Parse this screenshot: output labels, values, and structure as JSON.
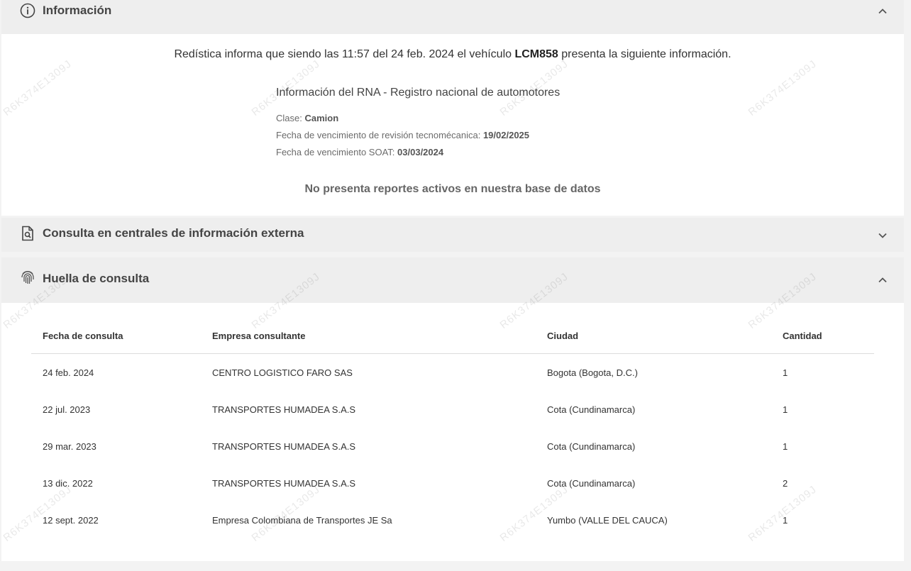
{
  "info_panel": {
    "title": "Información",
    "intro": {
      "prefix": "Redística informa que siendo las 11:57 del 24 feb. 2024 el vehículo ",
      "plate": "LCM858",
      "suffix": " presenta la siguiente información."
    },
    "rna": {
      "title": "Información del RNA - Registro nacional de automotores",
      "clase_label": "Clase:",
      "clase_value": "Camion",
      "tecno_label": "Fecha de vencimiento de revisión tecnomécanica:",
      "tecno_value": "19/02/2025",
      "soat_label": "Fecha de vencimiento SOAT:",
      "soat_value": "03/03/2024"
    },
    "no_reports": "No presenta reportes activos en nuestra base de datos"
  },
  "external_panel": {
    "title": "Consulta en centrales de información externa"
  },
  "huella_panel": {
    "title": "Huella de consulta",
    "columns": [
      "Fecha de consulta",
      "Empresa consultante",
      "Ciudad",
      "Cantidad"
    ],
    "rows": [
      [
        "24 feb. 2024",
        "CENTRO LOGISTICO FARO SAS",
        "Bogota (Bogota, D.C.)",
        "1"
      ],
      [
        "22 jul. 2023",
        "TRANSPORTES HUMADEA S.A.S",
        "Cota (Cundinamarca)",
        "1"
      ],
      [
        "29 mar. 2023",
        "TRANSPORTES HUMADEA S.A.S",
        "Cota (Cundinamarca)",
        "1"
      ],
      [
        "13 dic. 2022",
        "TRANSPORTES HUMADEA S.A.S",
        "Cota (Cundinamarca)",
        "2"
      ],
      [
        "12 sept. 2022",
        "Empresa Colombiana de Transportes JE Sa",
        "Yumbo (VALLE DEL CAUCA)",
        "1"
      ]
    ]
  },
  "watermark": "R6K374E1309J",
  "icons": {
    "info": "info-circle-icon",
    "external": "document-search-icon",
    "huella": "fingerprint-icon",
    "chevron_up": "chevron-up-icon",
    "chevron_down": "chevron-down-icon"
  },
  "colors": {
    "header_bg": "#eeeeee",
    "page_bg": "#f3f3f3",
    "text": "#3c4043"
  }
}
